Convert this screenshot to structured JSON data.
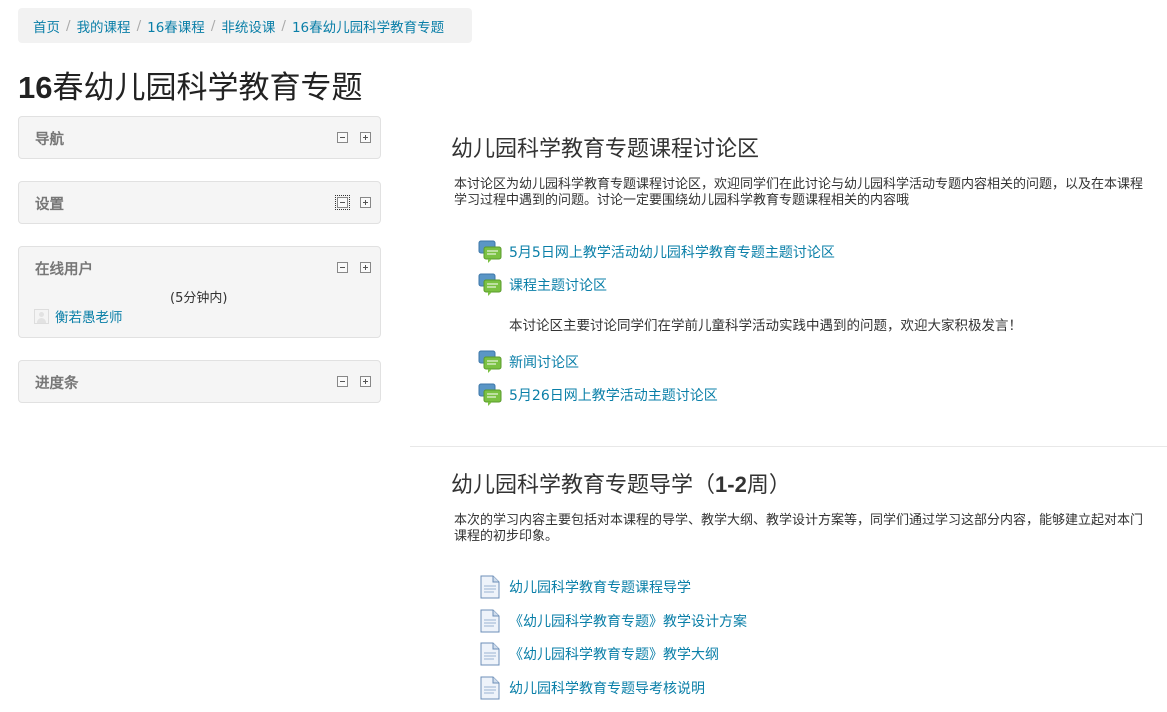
{
  "breadcrumb": [
    "首页",
    "我的课程",
    "16春课程",
    "非统设课",
    "16春幼儿园科学教育专题"
  ],
  "page_title": {
    "prefix": "16",
    "rest": "春幼儿园科学教育专题"
  },
  "blocks": {
    "nav": {
      "title": "导航"
    },
    "settings": {
      "title": "设置"
    },
    "online": {
      "title": "在线用户",
      "note": "(5分钟内)",
      "user": "衡若愚老师"
    },
    "progress": {
      "title": "进度条"
    }
  },
  "sections": [
    {
      "title": "幼儿园科学教育专题课程讨论区",
      "summary": "本讨论区为幼儿园科学教育专题课程讨论区，欢迎同学们在此讨论与幼儿园科学活动专题内容相关的问题，以及在本课程学习过程中遇到的问题。讨论一定要围绕幼儿园科学教育专题课程相关的内容哦",
      "activities": [
        {
          "label": "5月5日网上教学活动幼儿园科学教育专题主题讨论区",
          "icon": "forum-icon"
        },
        {
          "label": "课程主题讨论区",
          "icon": "forum-icon",
          "description": "本讨论区主要讨论同学们在学前儿童科学活动实践中遇到的问题，欢迎大家积极发言！"
        },
        {
          "label": "新闻讨论区",
          "icon": "forum-icon"
        },
        {
          "label": "5月26日网上教学活动主题讨论区",
          "icon": "forum-icon"
        }
      ]
    },
    {
      "title_a": "幼儿园科学教育专题导学（",
      "title_b": "1-2",
      "title_c": "周）",
      "summary": "本次的学习内容主要包括对本课程的导学、教学大纲、教学设计方案等，同学们通过学习这部分内容，能够建立起对本门课程的初步印象。",
      "activities": [
        {
          "label": "幼儿园科学教育专题课程导学",
          "icon": "page-icon"
        },
        {
          "label": "《幼儿园科学教育专题》教学设计方案",
          "icon": "page-icon"
        },
        {
          "label": "《幼儿园科学教育专题》教学大纲",
          "icon": "page-icon"
        },
        {
          "label": "幼儿园科学教育专题导考核说明",
          "icon": "page-icon"
        }
      ]
    }
  ],
  "colors": {
    "link": "#0a7fa8",
    "block_bg": "#f5f5f5",
    "forum_green": "#7bc142",
    "forum_blue": "#5a96c6"
  }
}
